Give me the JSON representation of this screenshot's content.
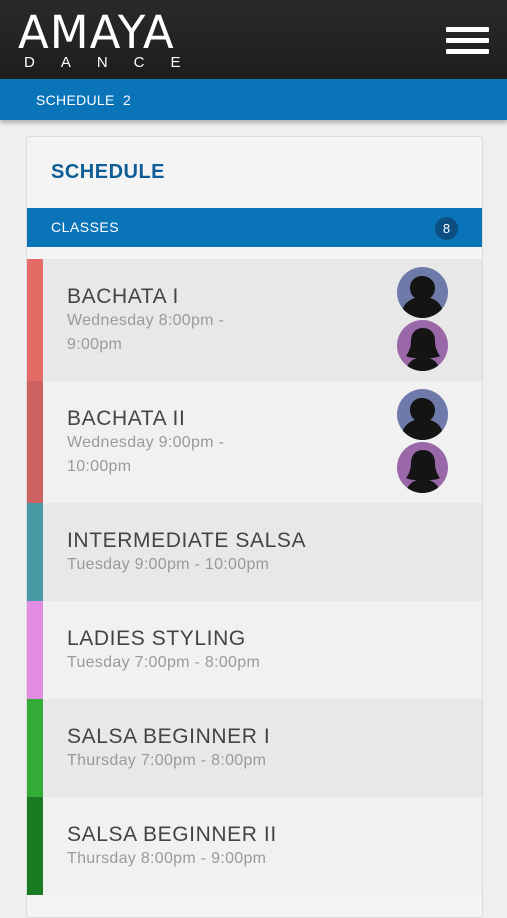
{
  "header": {
    "logo_main": "AMAYA",
    "logo_sub": "DANCE",
    "menu_icon": "hamburger-menu-icon"
  },
  "breadcrumb": {
    "label": "SCHEDULE",
    "count": "2"
  },
  "schedule": {
    "title": "SCHEDULE",
    "classes_label": "CLASSES",
    "classes_count": "8",
    "classes": [
      {
        "name": "BACHATA I",
        "time_line1": "Wednesday  8:00pm -",
        "time_line2": "9:00pm",
        "color": "#e56b66",
        "bg": "#e8e8e8",
        "avatars": [
          "male-instructor-avatar",
          "female-instructor-avatar"
        ]
      },
      {
        "name": "BACHATA II",
        "time_line1": "Wednesday  9:00pm -",
        "time_line2": "10:00pm",
        "color": "#cd6360",
        "bg": "#f1f1f1",
        "avatars": [
          "male-instructor-avatar",
          "female-instructor-avatar"
        ]
      },
      {
        "name": "INTERMEDIATE SALSA",
        "time_line1": "Tuesday  9:00pm - 10:00pm",
        "time_line2": "",
        "color": "#4a9aa6",
        "bg": "#e8e8e8",
        "avatars": []
      },
      {
        "name": "LADIES STYLING",
        "time_line1": "Tuesday  7:00pm - 8:00pm",
        "time_line2": "",
        "color": "#e28ce3",
        "bg": "#f1f1f1",
        "avatars": []
      },
      {
        "name": "SALSA BEGINNER I",
        "time_line1": "Thursday  7:00pm - 8:00pm",
        "time_line2": "",
        "color": "#34ad38",
        "bg": "#e8e8e8",
        "avatars": []
      },
      {
        "name": "SALSA BEGINNER II",
        "time_line1": "Thursday  8:00pm - 9:00pm",
        "time_line2": "",
        "color": "#1b7b23",
        "bg": "#f1f1f1",
        "avatars": []
      }
    ]
  },
  "colors": {
    "accent": "#0a74b9",
    "title": "#0e5d97",
    "male_avatar_bg": "#6e7aa9",
    "female_avatar_bg": "#9a68a8"
  }
}
